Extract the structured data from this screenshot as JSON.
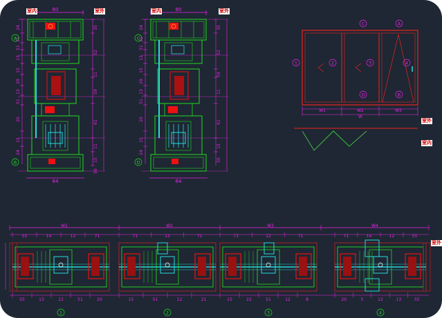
{
  "tags": {
    "indoor": "室内",
    "outdoor": "室外"
  },
  "colors": {
    "background": "#1e2733",
    "frame": "#22dd22",
    "dimension": "#ee22ee",
    "glass": "#22dddd",
    "gasket": "#ee1111",
    "hardware": "#ffffff"
  },
  "section_left": {
    "width_dim": "80",
    "grid_top": "A",
    "grid_bottom": "B",
    "dims_left": [
      "24",
      "21",
      "51",
      "13",
      "15",
      "29",
      "13",
      "51",
      "20",
      "15",
      "24"
    ],
    "dims_right": [
      "35",
      "52",
      "11",
      "59",
      "61",
      "11",
      "15",
      "50"
    ],
    "bottom_dim": "64"
  },
  "section_mid": {
    "width_dim": "80",
    "grid_top": "C",
    "grid_bottom": "D",
    "dims_left": [
      "24",
      "21",
      "51",
      "13",
      "15",
      "29",
      "13",
      "51",
      "20",
      "15",
      "24"
    ],
    "dims_right": [
      "35",
      "52",
      "59",
      "11",
      "61",
      "15",
      "50"
    ],
    "bottom_dim": "64"
  },
  "elevation": {
    "grid_left": "1",
    "markers_top": [
      "C",
      "A"
    ],
    "markers_panels": [
      "2",
      "3",
      "4"
    ],
    "markers_bottom": [
      "D",
      "B"
    ],
    "widths": [
      "W1",
      "W2",
      "W3"
    ],
    "total": "W"
  },
  "plan_sections": {
    "widths_top": [
      "W1",
      "W2",
      "W3",
      "W4"
    ],
    "labels": [
      "1",
      "2",
      "3",
      "4"
    ],
    "dims_1_top": [
      "55",
      "14",
      "12",
      "71"
    ],
    "dims_1_bottom": [
      "55",
      "13",
      "12",
      "51",
      "20"
    ],
    "dims_2_top": [
      "71",
      "12",
      "71"
    ],
    "dims_2_bottom": [
      "15",
      "51",
      "12",
      "21"
    ],
    "dims_3_top": [
      "71",
      "12",
      "71"
    ],
    "dims_3_bottom": [
      "15",
      "22",
      "51",
      "12",
      "8"
    ],
    "dims_4_top": [
      "71",
      "14",
      "12",
      "55"
    ],
    "dims_4_bottom": [
      "20",
      "5",
      "12",
      "13",
      "55"
    ]
  }
}
